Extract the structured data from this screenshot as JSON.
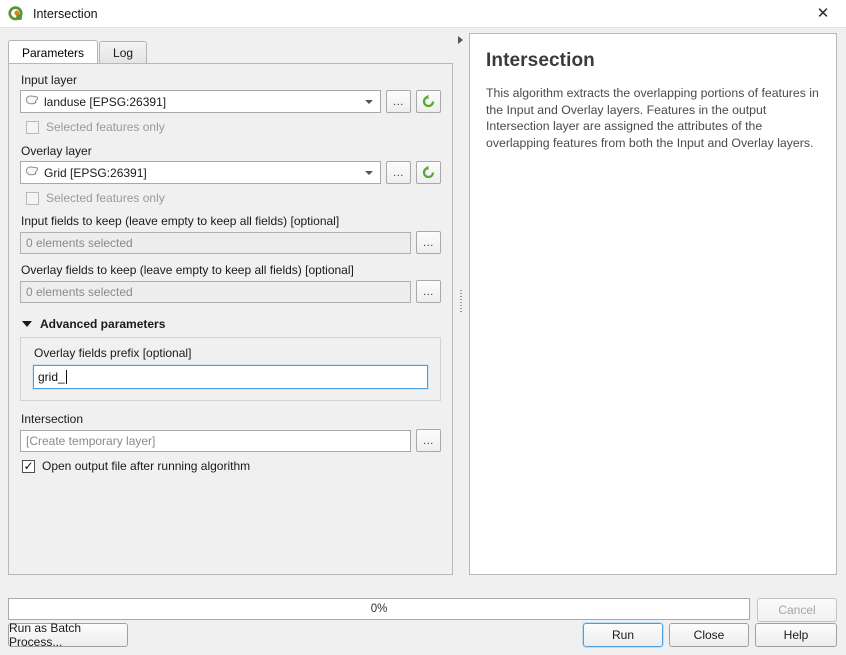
{
  "window": {
    "title": "Intersection",
    "icon": "qgis-logo-icon",
    "close_label": "✕"
  },
  "tabs": [
    {
      "label": "Parameters",
      "active": true
    },
    {
      "label": "Log",
      "active": false
    }
  ],
  "form": {
    "input_layer": {
      "label": "Input layer",
      "value": "landuse [EPSG:26391]",
      "browse_label": "...",
      "selected_only_label": "Selected features only",
      "selected_only_checked": false
    },
    "overlay_layer": {
      "label": "Overlay layer",
      "value": "Grid [EPSG:26391]",
      "browse_label": "...",
      "selected_only_label": "Selected features only",
      "selected_only_checked": false
    },
    "input_fields": {
      "label": "Input fields to keep (leave empty to keep all fields) [optional]",
      "value": "0 elements selected",
      "browse_label": "..."
    },
    "overlay_fields": {
      "label": "Overlay fields to keep (leave empty to keep all fields) [optional]",
      "value": "0 elements selected",
      "browse_label": "..."
    },
    "advanced": {
      "title": "Advanced parameters",
      "prefix_label": "Overlay fields prefix [optional]",
      "prefix_value": "grid_"
    },
    "output": {
      "label": "Intersection",
      "placeholder": "[Create temporary layer]",
      "browse_label": "...",
      "open_output_label": "Open output file after running algorithm",
      "open_output_checked": true
    }
  },
  "help": {
    "title": "Intersection",
    "body": "This algorithm extracts the overlapping portions of features in the Input and Overlay layers. Features in the output Intersection layer are assigned the attributes of the overlapping features from both the Input and Overlay layers."
  },
  "bottom": {
    "progress_text": "0%",
    "progress_percent": 0,
    "cancel_label": "Cancel",
    "batch_label": "Run as Batch Process...",
    "run_label": "Run",
    "close_label": "Close",
    "help_label": "Help"
  },
  "colors": {
    "accent": "#4a9fe0",
    "qgis_green": "#589632",
    "qgis_orange": "#d98023",
    "panel_bg": "#f0f0f0"
  }
}
